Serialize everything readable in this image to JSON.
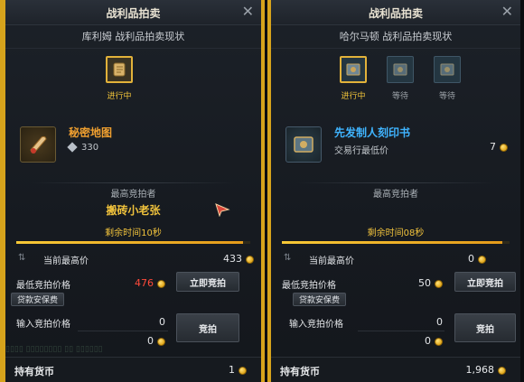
{
  "left": {
    "title": "战利品拍卖",
    "subtitle": "库利姆 战利品拍卖现状",
    "slots": [
      {
        "status": "进行中",
        "icon": "scroll-icon"
      }
    ],
    "item": {
      "name": "秘密地图",
      "level": "330",
      "name_color": "#f0a030"
    },
    "highest_bidder_label": "最高竞拍者",
    "highest_bidder": "搬砖小老张",
    "timer": "剩余时间10秒",
    "timer_progress": 0.97,
    "current_bid_label": "当前最高价",
    "current_bid": "433",
    "min_bid_label": "最低竞拍价格",
    "min_bid": "476",
    "buyout_button": "立即竞拍",
    "deposit_button": "贷款安保费",
    "input_label": "输入竞拍价格",
    "input_value": "0",
    "input_value2": "0",
    "bid_button": "竞拍",
    "currency_label": "持有货币",
    "currency_value": "1"
  },
  "right": {
    "title": "战利品拍卖",
    "subtitle": "哈尔马顿 战利品拍卖现状",
    "slots": [
      {
        "status": "进行中",
        "icon": "engraving-book-icon"
      },
      {
        "status": "等待",
        "icon": "engraving-book-icon"
      },
      {
        "status": "等待",
        "icon": "engraving-book-icon"
      }
    ],
    "item": {
      "name": "先发制人刻印书",
      "sub_label": "交易行最低价",
      "sub_value": "7",
      "name_color": "#3fb4ff"
    },
    "highest_bidder_label": "最高竞拍者",
    "highest_bidder": "",
    "timer": "剩余时间08秒",
    "timer_progress": 0.97,
    "current_bid_label": "当前最高价",
    "current_bid": "0",
    "min_bid_label": "最低竞拍价格",
    "min_bid": "50",
    "buyout_button": "立即竞拍",
    "deposit_button": "贷款安保费",
    "input_label": "输入竞拍价格",
    "input_value": "0",
    "input_value2": "0",
    "bid_button": "竞拍",
    "currency_label": "持有货币",
    "currency_value": "1,968"
  },
  "colors": {
    "accent_gold": "#f0c23c",
    "highlight_red": "#ff4a3a",
    "frame_yellow": "#d6a31c"
  }
}
